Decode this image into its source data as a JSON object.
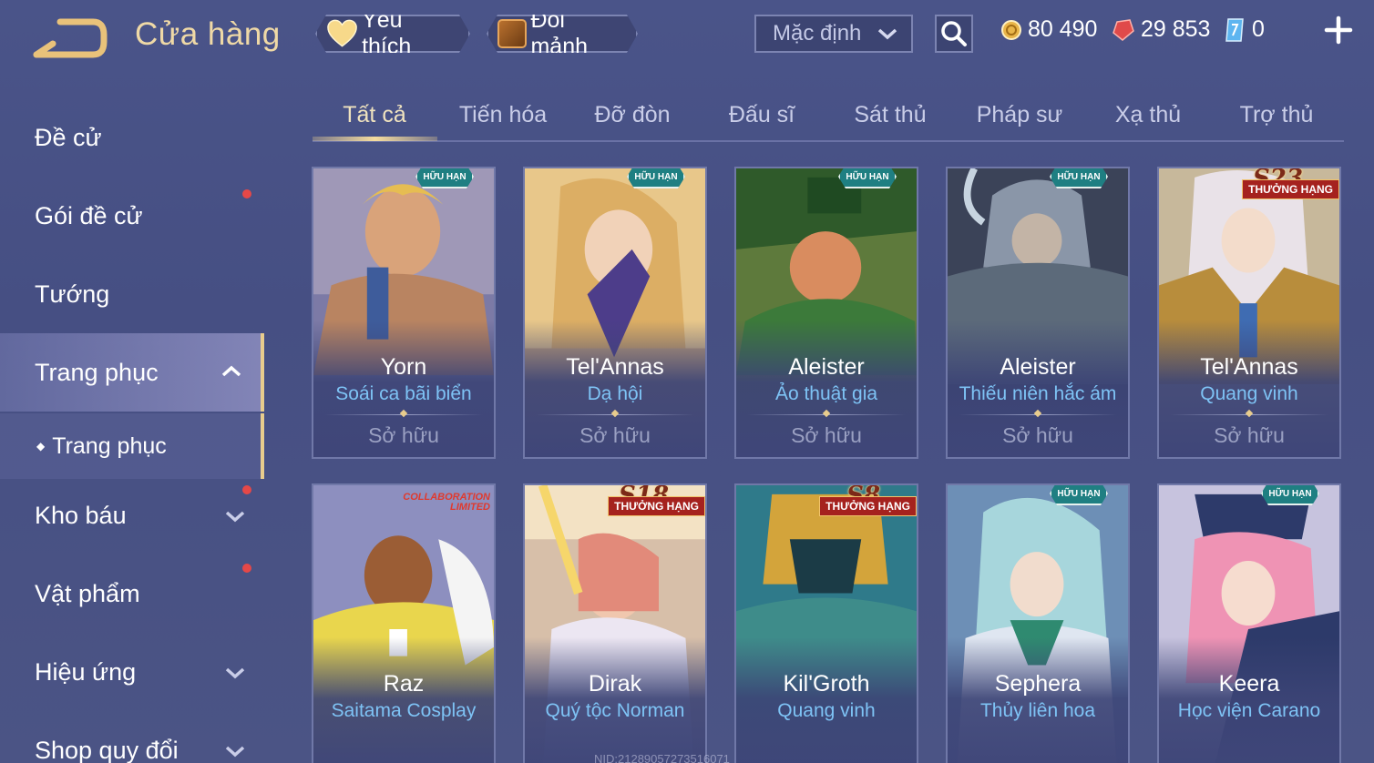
{
  "header": {
    "title": "Cửa hàng",
    "favorites_label": "Yêu thích",
    "exchange_label": "Đổi mảnh",
    "sort_value": "Mặc định",
    "currencies": {
      "gold": "80 490",
      "ruby": "29 853",
      "voucher": "0"
    }
  },
  "sidebar": {
    "items": [
      {
        "label": "Đề cử"
      },
      {
        "label": "Gói đề cử"
      },
      {
        "label": "Tướng"
      },
      {
        "label": "Trang phục"
      },
      {
        "label": "Kho báu"
      },
      {
        "label": "Vật phẩm"
      },
      {
        "label": "Hiệu ứng"
      },
      {
        "label": "Shop quy đổi"
      }
    ],
    "sub_item": "Trang phục"
  },
  "tabs": [
    {
      "label": "Tất cả"
    },
    {
      "label": "Tiến hóa"
    },
    {
      "label": "Đỡ đòn"
    },
    {
      "label": "Đấu sĩ"
    },
    {
      "label": "Sát thủ"
    },
    {
      "label": "Pháp sư"
    },
    {
      "label": "Xạ thủ"
    },
    {
      "label": "Trợ thủ"
    }
  ],
  "cards": [
    {
      "hero": "Yorn",
      "skin": "Soái ca bãi biển",
      "status": "Sở hữu",
      "badge": "A",
      "badge_text": "HỮU HẠN"
    },
    {
      "hero": "Tel'Annas",
      "skin": "Dạ hội",
      "status": "Sở hữu",
      "badge": "A",
      "badge_text": "HỮU HẠN"
    },
    {
      "hero": "Aleister",
      "skin": "Ảo thuật gia",
      "status": "Sở hữu",
      "badge": "A",
      "badge_text": "HỮU HẠN"
    },
    {
      "hero": "Aleister",
      "skin": "Thiếu niên hắc ám",
      "status": "Sở hữu",
      "badge": "A",
      "badge_text": "HỮU HẠN"
    },
    {
      "hero": "Tel'Annas",
      "skin": "Quang vinh",
      "status": "Sở hữu",
      "badge": "S23",
      "badge_text": "THƯỞNG HẠNG"
    },
    {
      "hero": "Raz",
      "skin": "Saitama Cosplay",
      "status": "",
      "badge": "COLLABORATION",
      "badge_text": "LIMITED"
    },
    {
      "hero": "Dirak",
      "skin": "Quý tộc Norman",
      "status": "",
      "badge": "S18",
      "badge_text": "THƯỞNG HẠNG"
    },
    {
      "hero": "Kil'Groth",
      "skin": "Quang vinh",
      "status": "",
      "badge": "S8",
      "badge_text": "THƯỞNG HẠNG"
    },
    {
      "hero": "Sephera",
      "skin": "Thủy liên hoa",
      "status": "",
      "badge": "A",
      "badge_text": "HỮU HẠN"
    },
    {
      "hero": "Keera",
      "skin": "Học viện Carano",
      "status": "",
      "badge": "A",
      "badge_text": "HỮU HẠN"
    }
  ],
  "watermark": "NID:21289057273516071",
  "colors": {
    "accent_gold": "#e8cc8d",
    "skin_name_blue": "#7ec3f5",
    "background": "#4a5489"
  }
}
